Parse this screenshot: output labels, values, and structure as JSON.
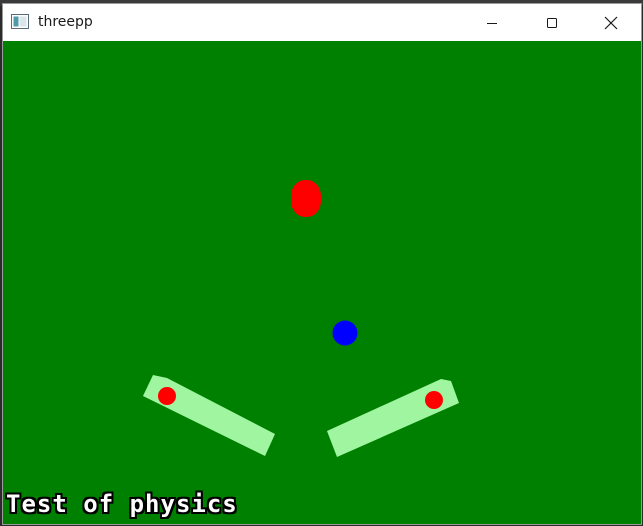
{
  "window": {
    "title": "threepp",
    "icon": "app-window-icon",
    "controls": [
      "minimize-icon",
      "maximize-icon",
      "close-icon"
    ]
  },
  "scene": {
    "background_color": "#008000",
    "hud_text": "Test of physics",
    "objects": [
      {
        "name": "red-capsule",
        "color": "#ff0000"
      },
      {
        "name": "blue-ball",
        "color": "#0000ff"
      },
      {
        "name": "left-flipper",
        "color": "#a0f5a0",
        "pivot_color": "#ff0000"
      },
      {
        "name": "right-flipper",
        "color": "#a0f5a0",
        "pivot_color": "#ff0000"
      }
    ]
  }
}
